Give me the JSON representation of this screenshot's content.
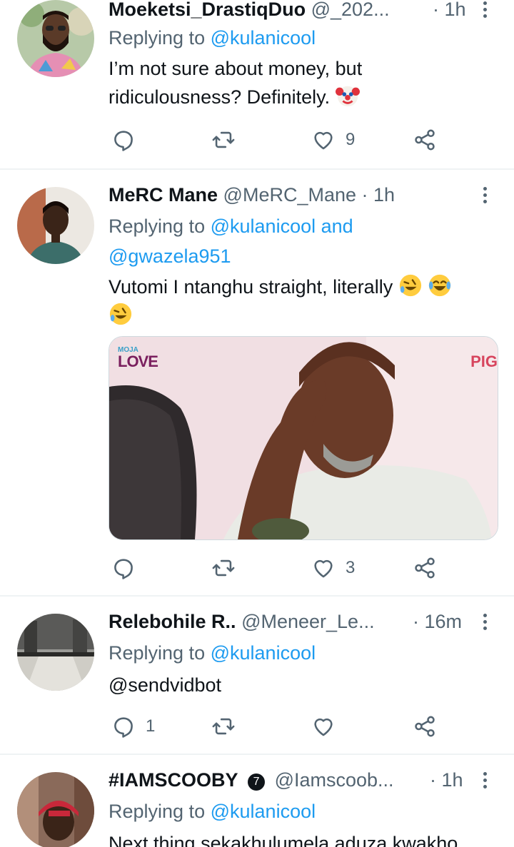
{
  "tweets": [
    {
      "name": "Moeketsi_DrastiqDuo",
      "handle": "@_202...",
      "time": "· 1h",
      "replying_label": "Replying to",
      "replying_to": "@kulanicool",
      "text": "I’m not sure about money, but ridiculousness? Definitely.",
      "text_emoji": "clown-face-emoji",
      "replies": "",
      "retweets": "",
      "likes": "9"
    },
    {
      "name": "MeRC Mane",
      "handle": "@MeRC_Mane",
      "time": "· 1h",
      "replying_label": "Replying to",
      "replying_to": "@kulanicool and",
      "replying_to_2": "@gwazela951",
      "text": "Vutomi I ntanghu straight, literally",
      "text_emoji": "rolling-on-floor-laughing-emoji",
      "media_logo_small": "MOJA",
      "media_logo_big": "LOVE",
      "media_corner_text": "PIG",
      "replies": "",
      "retweets": "",
      "likes": "3"
    },
    {
      "name": "Relebohile R..",
      "handle": "@Meneer_Le...",
      "time": "· 16m",
      "replying_label": "Replying to",
      "replying_to": "@kulanicool",
      "text": "@sendvidbot",
      "replies": "1",
      "retweets": "",
      "likes": ""
    },
    {
      "name": "#IAMSCOOBY",
      "verified_badge": "7",
      "handle": "@Iamscoob...",
      "time": "· 1h",
      "replying_label": "Replying to",
      "replying_to": "@kulanicool",
      "text": "Next thing sekakhulumela aduza kwakho"
    }
  ],
  "colors": {
    "link": "#1d9bf0",
    "secondary_text": "#536471",
    "primary_text": "#0f1419",
    "divider": "#eff3f4"
  },
  "icons": {
    "reply": "reply-icon",
    "retweet": "retweet-icon",
    "like": "heart-icon",
    "share": "share-icon",
    "more": "more-vertical-icon"
  }
}
